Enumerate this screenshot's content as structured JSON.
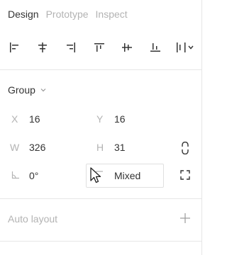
{
  "tabs": [
    {
      "label": "Design",
      "active": true
    },
    {
      "label": "Prototype",
      "active": false
    },
    {
      "label": "Inspect",
      "active": false
    }
  ],
  "align_tools": [
    {
      "name": "align-left",
      "icon": "align-left-icon"
    },
    {
      "name": "align-horizontal-center",
      "icon": "align-horizontal-center-icon"
    },
    {
      "name": "align-right",
      "icon": "align-right-icon"
    },
    {
      "name": "align-top",
      "icon": "align-top-icon"
    },
    {
      "name": "align-vertical-center",
      "icon": "align-vertical-center-icon"
    },
    {
      "name": "align-bottom",
      "icon": "align-bottom-icon"
    },
    {
      "name": "distribute-menu",
      "icon": "distribute-icon"
    }
  ],
  "group": {
    "title": "Group",
    "x_label": "X",
    "x_value": "16",
    "y_label": "Y",
    "y_value": "16",
    "w_label": "W",
    "w_value": "326",
    "h_label": "H",
    "h_value": "31",
    "rotation_value": "0°",
    "radius_value": "Mixed"
  },
  "auto_layout": {
    "title": "Auto layout"
  },
  "colors": {
    "text": "#333333",
    "muted": "#b3b3b3",
    "divider": "#e6e6e6",
    "icon": "#333333"
  }
}
